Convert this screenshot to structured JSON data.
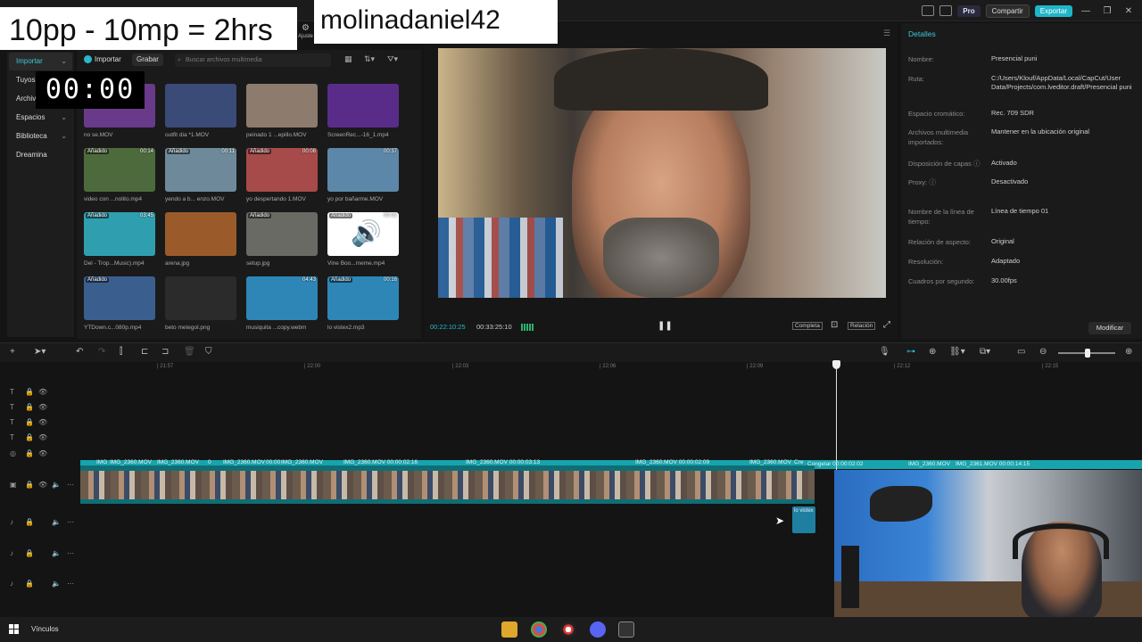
{
  "overlay": {
    "title": "10pp - 10mp = 2hrs",
    "username": "molinadaniel42",
    "timer": "00:00"
  },
  "topbar": {
    "ajustes": "Ajuste",
    "pro": "Pro",
    "share": "Compartir",
    "export": "Exportar"
  },
  "nav": {
    "items": [
      {
        "label": "Importar",
        "active": true,
        "caret": true
      },
      {
        "label": "Tuyos",
        "active": false,
        "caret": false
      },
      {
        "label": "Archiv",
        "active": false,
        "caret": false
      },
      {
        "label": "Espacios",
        "active": false,
        "caret": true
      },
      {
        "label": "Biblioteca",
        "active": false,
        "caret": true
      },
      {
        "label": "Dreamina",
        "active": false,
        "caret": false
      }
    ]
  },
  "media": {
    "import_label": "Importar",
    "record_label": "Grabar",
    "search_placeholder": "Buscar archivos multimedia",
    "items": [
      {
        "caption": "no se.MOV",
        "tag": "",
        "dur": "",
        "color": "#6a3a8a"
      },
      {
        "caption": "outfit dia *1.MOV",
        "tag": "",
        "dur": "",
        "color": "#3b4b78"
      },
      {
        "caption": "peinado 1 ...epillo.MOV",
        "tag": "",
        "dur": "",
        "color": "#8d7b6e"
      },
      {
        "caption": "ScreenRec...-16_1.mp4",
        "tag": "",
        "dur": "",
        "color": "#5a2c8a"
      },
      {
        "caption": "video con ...nolito.mp4",
        "tag": "Añadido",
        "dur": "00:14",
        "color": "#4d6a3c"
      },
      {
        "caption": "yendo a b... enzo.MOV",
        "tag": "Añadido",
        "dur": "00:11",
        "color": "#6e8a9a"
      },
      {
        "caption": "yo despertando 1.MOV",
        "tag": "Añadido",
        "dur": "00:08",
        "color": "#a74a4a"
      },
      {
        "caption": "yo por bañarme.MOV",
        "tag": "",
        "dur": "00:37",
        "color": "#5d87a8"
      },
      {
        "caption": "Del - Trop...Music).mp4",
        "tag": "Añadido",
        "dur": "03:45",
        "color": "#2f9fb0"
      },
      {
        "caption": "arena.jpg",
        "tag": "",
        "dur": "",
        "color": "#9a5a2a"
      },
      {
        "caption": "setup.jpg",
        "tag": "Añadido",
        "dur": "",
        "color": "#6a6a64"
      },
      {
        "caption": "Vine Boo...meme.mp4",
        "tag": "Añadido",
        "dur": "00:02",
        "color": "#ffffff",
        "speaker": "🔊"
      },
      {
        "caption": "YTDown.c...080p.mp4",
        "tag": "Añadido",
        "dur": "",
        "color": "#3a5f8f"
      },
      {
        "caption": "beto metegol.png",
        "tag": "",
        "dur": "",
        "color": "#2b2b2b"
      },
      {
        "caption": "musiquita ...copy.webm",
        "tag": "",
        "dur": "04:43",
        "color": "#2e86b7"
      },
      {
        "caption": "lo vistex2.mp3",
        "tag": "Añadido",
        "dur": "00:16",
        "color": "#2e86b7"
      }
    ]
  },
  "preview": {
    "current_time": "00:22:10:25",
    "total_time": "00:33:25:10",
    "btn_completa": "Completa",
    "btn_relacion": "Relación"
  },
  "details": {
    "title": "Detalles",
    "rows": [
      {
        "k": "Nombre:",
        "v": "Presencial puni"
      },
      {
        "k": "Ruta:",
        "v": "C:/Users/Klouf/AppData/Local/CapCut/User Data/Projects/com.lveditor.draft/Presencial puni"
      },
      {
        "k": "Espacio cromático:",
        "v": "Rec. 709 SDR"
      },
      {
        "k": "Archivos multimedia importados:",
        "v": "Mantener en la ubicación original"
      },
      {
        "k": "Disposición de capas ⓘ",
        "v": "Activado"
      },
      {
        "k": "Proxy: ⓘ",
        "v": "Desactivado"
      },
      {
        "k": "Nombre de la línea de tiempo:",
        "v": "Línea de tiempo 01"
      },
      {
        "k": "Relación de aspecto:",
        "v": "Original"
      },
      {
        "k": "Resolución:",
        "v": "Adaptado"
      },
      {
        "k": "Cuadros por segundo:",
        "v": "30.00fps"
      }
    ],
    "modify": "Modificar"
  },
  "timeline": {
    "ruler_ticks": [
      "| 21:57",
      "| 22:00",
      "| 22:03",
      "| 22:06",
      "| 22:09",
      "| 22:12",
      "| 22:15"
    ],
    "clip_labels": [
      "IMG",
      "IMG_2360.MOV",
      "IMG_2360.MOV",
      "0",
      "IMG_2360.MOV",
      "00:00",
      "IMG_2360.MOV",
      "",
      "IMG_2360.MOV  00:00:02:16",
      "IMG_2360.MOV  00:00:03:13",
      "IMG_2360.MOV  00:00:02:09",
      "IMG_2360.MOV",
      "Cre"
    ],
    "right_labels": [
      "Congelar  00:00:02:02",
      "IMG_2360.MOV",
      "IMG_2361.MOV  00:00:14:15"
    ],
    "audio_label": "lo vistex"
  },
  "taskbar": {
    "label": "Vínculos"
  }
}
